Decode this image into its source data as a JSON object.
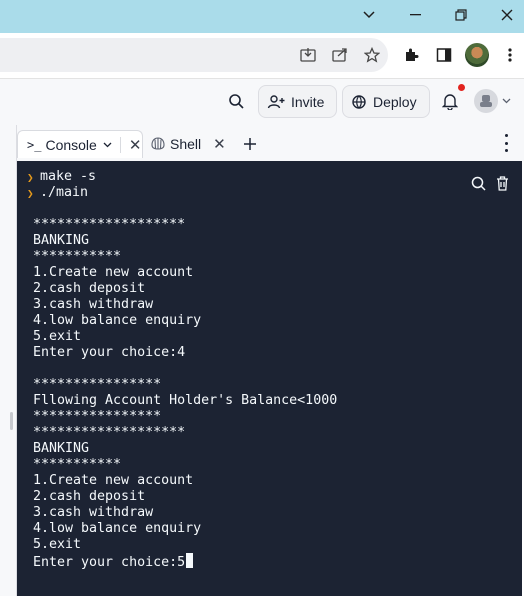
{
  "window_controls": [
    "chevron-down",
    "minimize",
    "restore",
    "close"
  ],
  "toolbar": {
    "icons": [
      "install-app-icon",
      "share-icon",
      "bookmark-star-icon",
      "extensions-icon",
      "side-panel-icon",
      "profile-avatar-icon"
    ]
  },
  "header": {
    "invite_label": "Invite",
    "deploy_label": "Deploy"
  },
  "tabs": [
    {
      "label": "Console",
      "active": true
    },
    {
      "label": "Shell",
      "active": false
    }
  ],
  "console": {
    "commands": [
      "make -s",
      "./main"
    ],
    "lines": [
      "*******************",
      "BANKING",
      "***********",
      "1.Create new account",
      "2.cash deposit",
      "3.cash withdraw",
      "4.low balance enquiry",
      "5.exit",
      "Enter your choice:4",
      "",
      "****************",
      "Fllowing Account Holder's Balance<1000",
      "****************",
      "*******************",
      "BANKING",
      "***********",
      "1.Create new account",
      "2.cash deposit",
      "3.cash withdraw",
      "4.low balance enquiry",
      "5.exit",
      "Enter your choice:5"
    ]
  }
}
